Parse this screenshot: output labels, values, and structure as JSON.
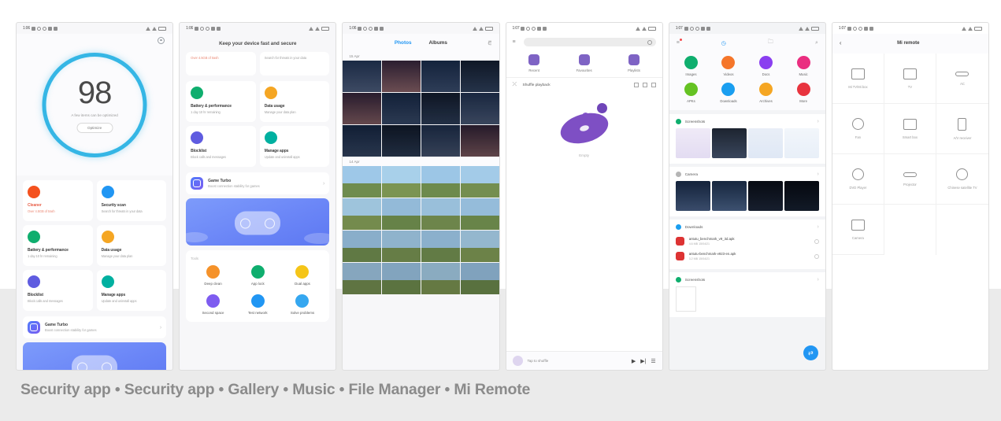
{
  "caption": "Security app • Security app • Gallery • Music • File Manager • Mi Remote",
  "status_bar": {
    "time_1": "1:06",
    "time_2": "1:07"
  },
  "phone1": {
    "app": "Security app",
    "score": "98",
    "score_sub": "A few items can be optimized",
    "optimize_label": "Optimize",
    "tiles": [
      {
        "title": "Cleaner",
        "desc": "Over 4.5GB of trash",
        "color": "#f4511e",
        "icon": "trash-icon",
        "accent": "red"
      },
      {
        "title": "Security scan",
        "desc": "Search for threats in your data",
        "color": "#2196f3",
        "icon": "shield-icon",
        "accent": ""
      },
      {
        "title": "Battery & performance",
        "desc": "1 day 10 hr remaining",
        "color": "#0fae6e",
        "icon": "battery-icon",
        "accent": ""
      },
      {
        "title": "Data usage",
        "desc": "Manage your data plan",
        "color": "#f5a623",
        "icon": "data-icon",
        "accent": ""
      },
      {
        "title": "Blocklist",
        "desc": "Block calls and messages",
        "color": "#5f5ce0",
        "icon": "block-icon",
        "accent": ""
      },
      {
        "title": "Manage apps",
        "desc": "Update and uninstall apps",
        "color": "#00b0a0",
        "icon": "apps-icon",
        "accent": ""
      }
    ],
    "game_turbo": {
      "title": "Game Turbo",
      "desc": "Boost connection stability for games",
      "chevron": "›"
    }
  },
  "phone2": {
    "app": "Security app",
    "headline": "Keep your device fast and secure",
    "strip": [
      {
        "text": "Over 4.5GB of trash",
        "accent": "red"
      },
      {
        "text": "Search for threats in your data",
        "accent": ""
      }
    ],
    "tiles": [
      {
        "title": "Battery & performance",
        "desc": "1 day 10 hr remaining",
        "color": "#0fae6e",
        "icon": "battery-icon"
      },
      {
        "title": "Data usage",
        "desc": "Manage your data plan",
        "color": "#f5a623",
        "icon": "data-icon"
      },
      {
        "title": "Blocklist",
        "desc": "Block calls and messages",
        "color": "#5f5ce0",
        "icon": "block-icon"
      },
      {
        "title": "Manage apps",
        "desc": "Update and uninstall apps",
        "color": "#00b0a0",
        "icon": "apps-icon"
      }
    ],
    "game_turbo": {
      "title": "Game Turbo",
      "desc": "Boost connection stability for games",
      "chevron": "›"
    },
    "shortcuts_title": "Tools",
    "shortcuts": [
      {
        "label": "Deep clean",
        "color": "#f5922a",
        "icon": "deep-clean-icon"
      },
      {
        "label": "App lock",
        "color": "#0fae6e",
        "icon": "lock-icon"
      },
      {
        "label": "Dual apps",
        "color": "#f5c518",
        "icon": "dual-apps-icon"
      },
      {
        "label": "Second space",
        "color": "#7e5cf0",
        "icon": "second-space-icon"
      },
      {
        "label": "Test network",
        "color": "#2196f3",
        "icon": "network-icon"
      },
      {
        "label": "Solve problems",
        "color": "#35a7f0",
        "icon": "solve-icon"
      }
    ]
  },
  "phone3": {
    "app": "Gallery",
    "tabs": [
      {
        "label": "Photos",
        "active": true
      },
      {
        "label": "Albums",
        "active": false
      }
    ],
    "more_icon": "more-options-icon",
    "sections": [
      {
        "date": "15 Apr"
      },
      {
        "date": "14 Apr"
      }
    ],
    "grid_columns": 4
  },
  "phone4": {
    "app": "Music",
    "search_placeholder": "",
    "categories": [
      {
        "label": "Recent",
        "icon": "clock-icon"
      },
      {
        "label": "Favourites",
        "icon": "heart-icon"
      },
      {
        "label": "Playlists",
        "icon": "playlist-icon"
      }
    ],
    "shuffle_label": "Shuffle playback",
    "empty_label": "Empty",
    "now_playing": "Tap to shuffle",
    "controls": [
      "play-icon",
      "next-icon",
      "queue-icon"
    ]
  },
  "phone5": {
    "app": "File Manager",
    "toolbar": [
      "menu-icon",
      "recent-icon",
      "new-folder-icon",
      "search-icon"
    ],
    "categories": [
      {
        "label": "Images",
        "color": "#0fae6e",
        "icon": "image-icon"
      },
      {
        "label": "Videos",
        "color": "#f5762a",
        "icon": "video-icon"
      },
      {
        "label": "Docs",
        "color": "#8a3ff0",
        "icon": "doc-icon"
      },
      {
        "label": "Music",
        "color": "#ea2e80",
        "icon": "music-note-icon"
      },
      {
        "label": "APKs",
        "color": "#65c223",
        "icon": "apk-icon"
      },
      {
        "label": "Downloads",
        "color": "#1a9ef0",
        "icon": "download-icon"
      },
      {
        "label": "Archives",
        "color": "#f5a623",
        "icon": "archive-icon"
      },
      {
        "label": "More",
        "color": "#e8343f",
        "icon": "more-icon"
      }
    ],
    "sections": [
      {
        "title": "Screenshots",
        "color": "#0fae6e",
        "chevron": "›"
      },
      {
        "title": "Camera",
        "color": "#8a8a8a",
        "chevron": "›"
      },
      {
        "title": "Downloads",
        "color": "#1a9ef0",
        "chevron": "›"
      },
      {
        "title": "Screenshots",
        "color": "#0fae6e",
        "chevron": "›"
      }
    ],
    "files": [
      {
        "name": "antutu_benchmark_v9_3d.apk",
        "meta": "4.6 MB  15/04/21"
      },
      {
        "name": "antutu-benchmark-v923-en.apk",
        "meta": "3.2 MB  15/04/21"
      }
    ],
    "fab_icon": "transfer-icon"
  },
  "phone6": {
    "app": "Mi Remote",
    "back_icon": "back-arrow-icon",
    "title": "Mi remote",
    "devices": [
      {
        "label": "Mi TV/Mi box",
        "icon": "mi-box-icon",
        "shape": "box"
      },
      {
        "label": "TV",
        "icon": "tv-icon",
        "shape": "tv"
      },
      {
        "label": "AC",
        "icon": "ac-icon",
        "shape": "thin"
      },
      {
        "label": "Fan",
        "icon": "fan-icon",
        "shape": "circle"
      },
      {
        "label": "Smart box",
        "icon": "smart-box-icon",
        "shape": "box"
      },
      {
        "label": "A/V receiver",
        "icon": "av-receiver-icon",
        "shape": "tall"
      },
      {
        "label": "DVD Player",
        "icon": "dvd-player-icon",
        "shape": "circle"
      },
      {
        "label": "Projector",
        "icon": "projector-icon",
        "shape": "thin"
      },
      {
        "label": "Chinese satellite TV",
        "icon": "satellite-tv-icon",
        "shape": "circle"
      },
      {
        "label": "Camera",
        "icon": "camera-icon",
        "shape": "box"
      },
      {
        "label": "",
        "icon": "",
        "shape": ""
      },
      {
        "label": "",
        "icon": "",
        "shape": ""
      }
    ]
  }
}
